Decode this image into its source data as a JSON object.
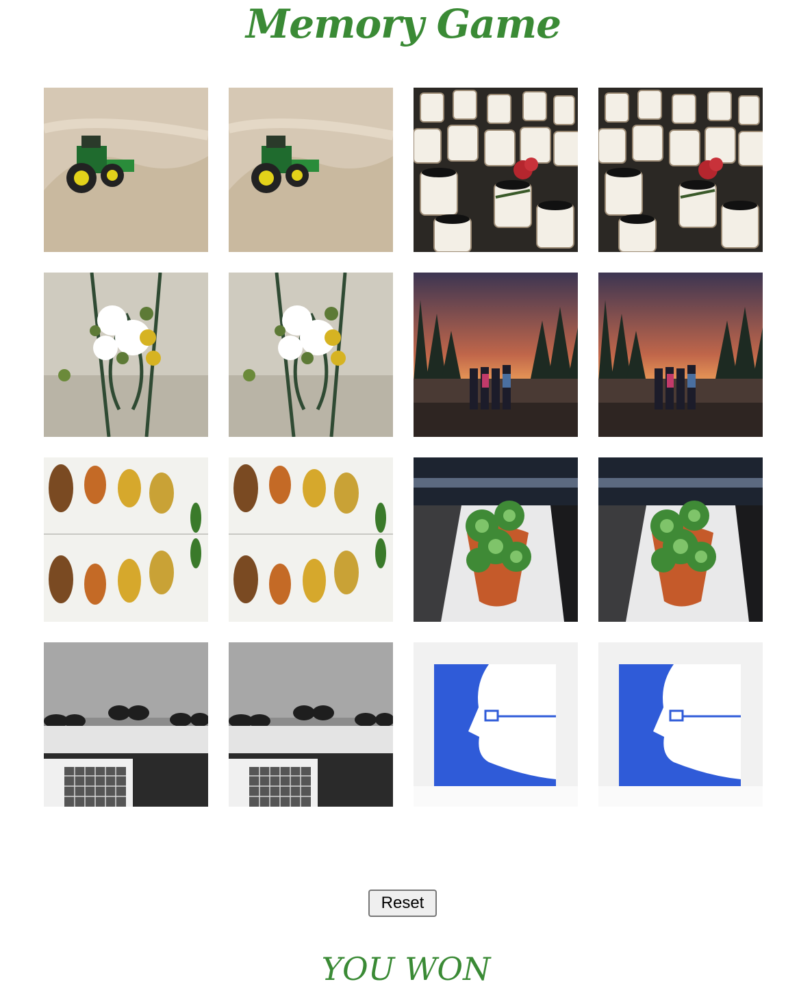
{
  "title": "Memory Game",
  "accent_color": "#3a8a35",
  "cards": [
    {
      "image": "toy-tractor-in-sand",
      "matched": true
    },
    {
      "image": "toy-tractor-in-sand",
      "matched": true
    },
    {
      "image": "memorial-candles-with-rose",
      "matched": true
    },
    {
      "image": "memorial-candles-with-rose",
      "matched": true
    },
    {
      "image": "flowers-on-gravestone",
      "matched": true
    },
    {
      "image": "flowers-on-gravestone",
      "matched": true
    },
    {
      "image": "group-at-forest-sunset",
      "matched": true
    },
    {
      "image": "group-at-forest-sunset",
      "matched": true
    },
    {
      "image": "autumn-leaves-reflection",
      "matched": true
    },
    {
      "image": "autumn-leaves-reflection",
      "matched": true
    },
    {
      "image": "succulent-in-pot",
      "matched": true
    },
    {
      "image": "succulent-in-pot",
      "matched": true
    },
    {
      "image": "shoes-on-shelf-bw",
      "matched": true
    },
    {
      "image": "shoes-on-shelf-bw",
      "matched": true
    },
    {
      "image": "blue-face-with-glasses-poster",
      "matched": true
    },
    {
      "image": "blue-face-with-glasses-poster",
      "matched": true
    }
  ],
  "reset_label": "Reset",
  "status_text": "YOU WON"
}
